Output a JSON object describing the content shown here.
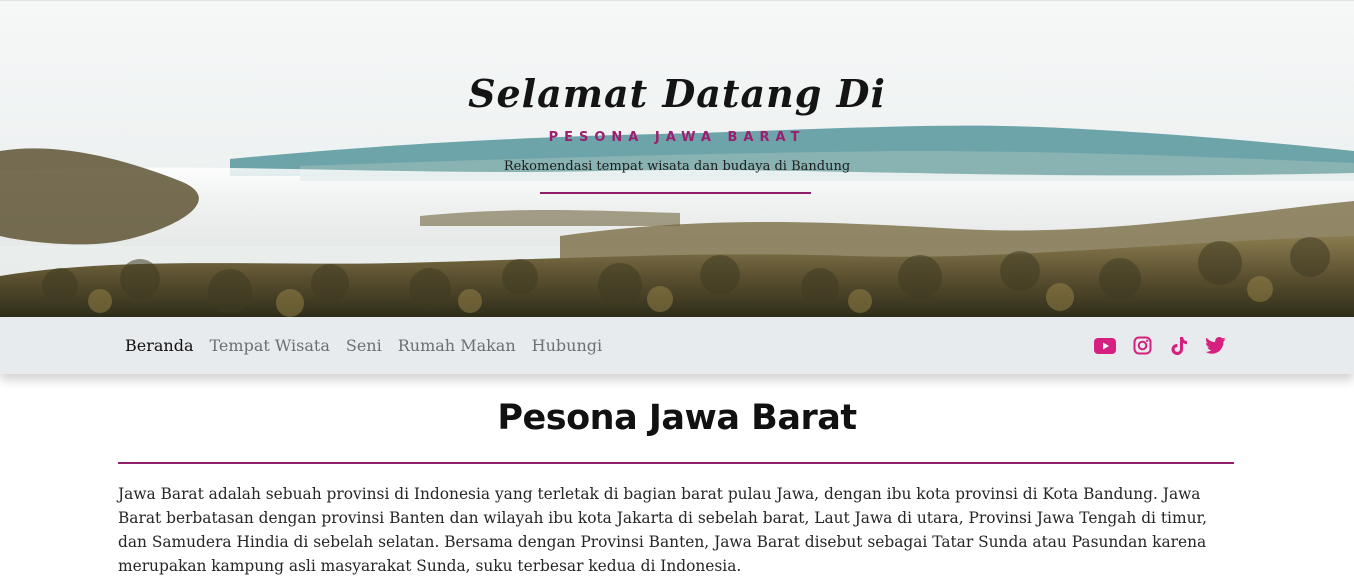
{
  "hero": {
    "title": "Selamat Datang Di",
    "subtitle": "PESONA JAWA BARAT",
    "tagline": "Rekomendasi tempat wisata dan budaya di Bandung"
  },
  "nav": {
    "links": [
      "Beranda",
      "Tempat Wisata",
      "Seni",
      "Rumah Makan",
      "Hubungi"
    ],
    "active": "Beranda",
    "social": [
      "youtube-icon",
      "instagram-icon",
      "tiktok-icon",
      "twitter-icon"
    ]
  },
  "main": {
    "title": "Pesona Jawa Barat",
    "paragraph": "Jawa Barat adalah sebuah provinsi di Indonesia yang terletak di bagian barat pulau Jawa, dengan ibu kota provinsi di Kota Bandung. Jawa Barat berbatasan dengan provinsi Banten dan wilayah ibu kota Jakarta di sebelah barat, Laut Jawa di utara, Provinsi Jawa Tengah di timur, dan Samudera Hindia di sebelah selatan. Bersama dengan Provinsi Banten, Jawa Barat disebut sebagai Tatar Sunda atau Pasundan karena merupakan kampung asli masyarakat Sunda, suku terbesar kedua di Indonesia."
  },
  "colors": {
    "accent": "#8f1f67",
    "social_icon": "#d6207f",
    "nav_bg": "#e8ebee"
  }
}
